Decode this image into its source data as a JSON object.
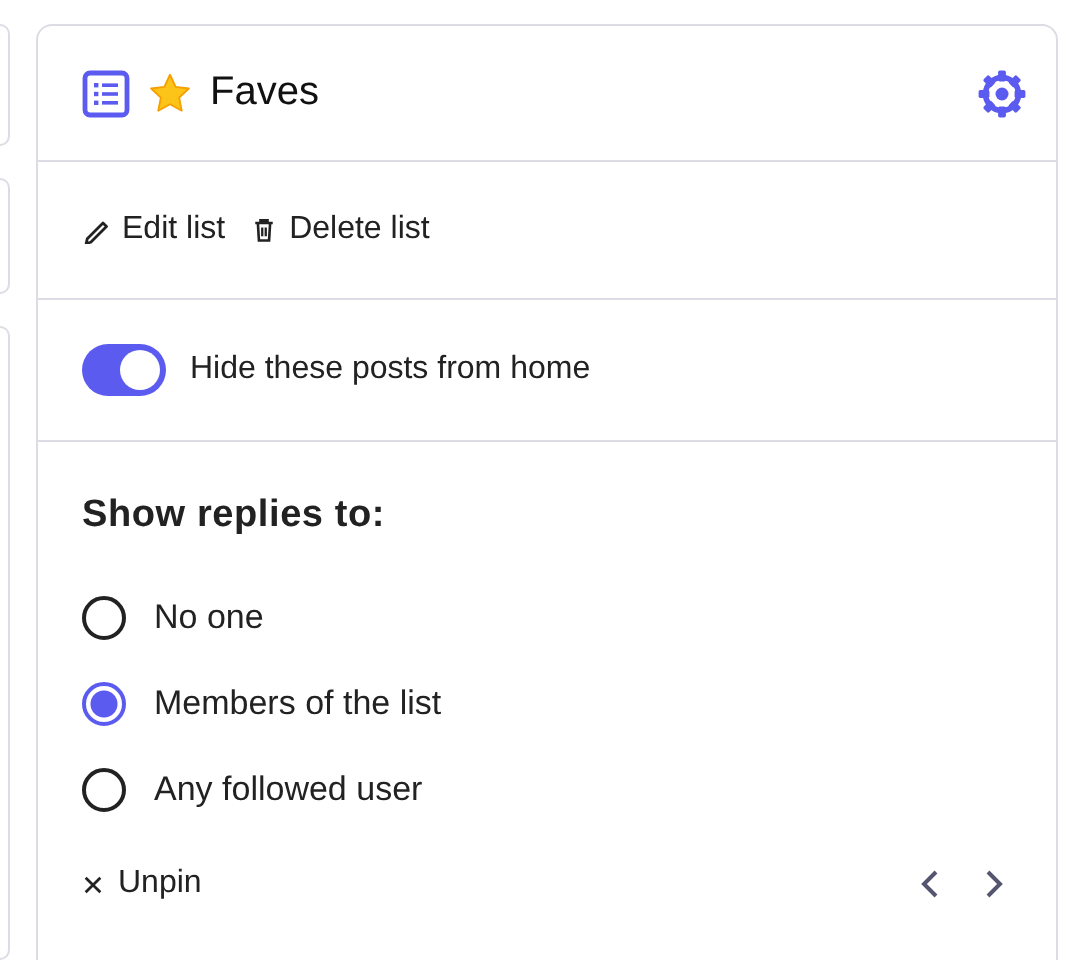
{
  "list": {
    "title": "Faves"
  },
  "actions": [
    {
      "kind": "edit",
      "label": "Edit list"
    },
    {
      "kind": "delete",
      "label": "Delete list"
    }
  ],
  "hide_toggle": {
    "label": "Hide these posts from home",
    "on": true
  },
  "replies": {
    "heading": "Show replies to:",
    "options": [
      {
        "label": "No one",
        "selected": false
      },
      {
        "label": "Members of the list",
        "selected": true
      },
      {
        "label": "Any followed user",
        "selected": false
      }
    ]
  },
  "unpin": {
    "label": "Unpin"
  }
}
